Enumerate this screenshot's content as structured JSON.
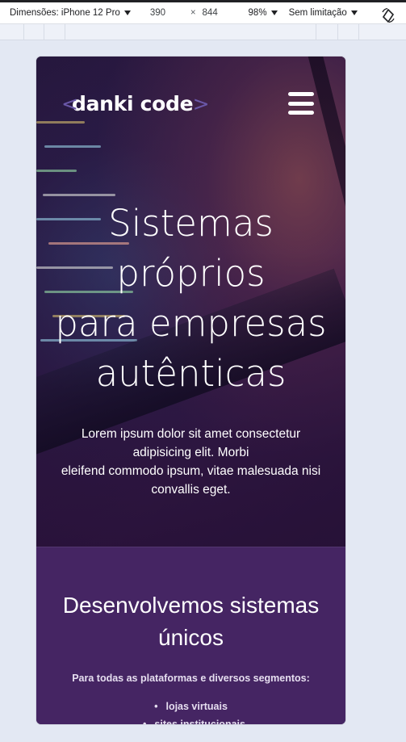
{
  "devtools": {
    "dimensions_label": "Dimensões: iPhone 12 Pro",
    "width_value": "390",
    "times": "×",
    "height_value": "844",
    "zoom": "98%",
    "throttle": "Sem limitação"
  },
  "header": {
    "logo_text": "danki code",
    "bracket_left": "<",
    "bracket_right": ">"
  },
  "hero": {
    "title_lines": [
      "Sistemas",
      "próprios",
      "para empresas",
      "autênticas"
    ],
    "subtitle_lines": [
      "Lorem ipsum dolor sit amet consectetur",
      "adipisicing elit. Morbi",
      "eleifend commodo ipsum, vitae malesuada nisi",
      "convallis eget."
    ]
  },
  "section": {
    "title_lines": [
      "Desenvolvemos sistemas",
      "únicos"
    ],
    "lead": "Para todas as plataformas e diversos segmentos:",
    "items": [
      "lojas virtuais",
      "sites institucionais"
    ]
  },
  "colors": {
    "section_bg": "#452563",
    "logo_bracket": "#6a57a8"
  }
}
